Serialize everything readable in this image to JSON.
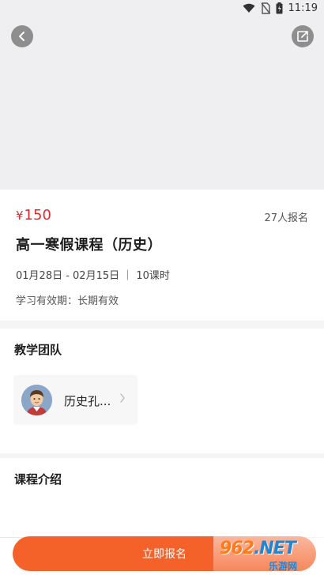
{
  "status_bar": {
    "time": "11:19",
    "icons": [
      "wifi-icon",
      "no-sim-icon",
      "battery-icon"
    ]
  },
  "header": {
    "back_icon": "chevron-left-icon",
    "share_icon": "share-icon"
  },
  "course": {
    "currency": "¥",
    "price": "150",
    "enroll_count": "27人报名",
    "title": "高一寒假课程（历史）",
    "dates": "01月28日 - 02月15日 ｜ 10课时",
    "validity": "学习有效期：长期有效"
  },
  "team": {
    "title": "教学团队",
    "teachers": [
      {
        "name": "历史孔..."
      }
    ]
  },
  "intro": {
    "title": "课程介绍"
  },
  "footer": {
    "enroll_button": "立即报名"
  },
  "watermark": {
    "brand_number": "962",
    "brand_suffix": ".NET",
    "brand_cn": "乐游网"
  },
  "colors": {
    "price": "#e02a2a",
    "accent": "#f4622a",
    "banner": "#efeef0"
  }
}
